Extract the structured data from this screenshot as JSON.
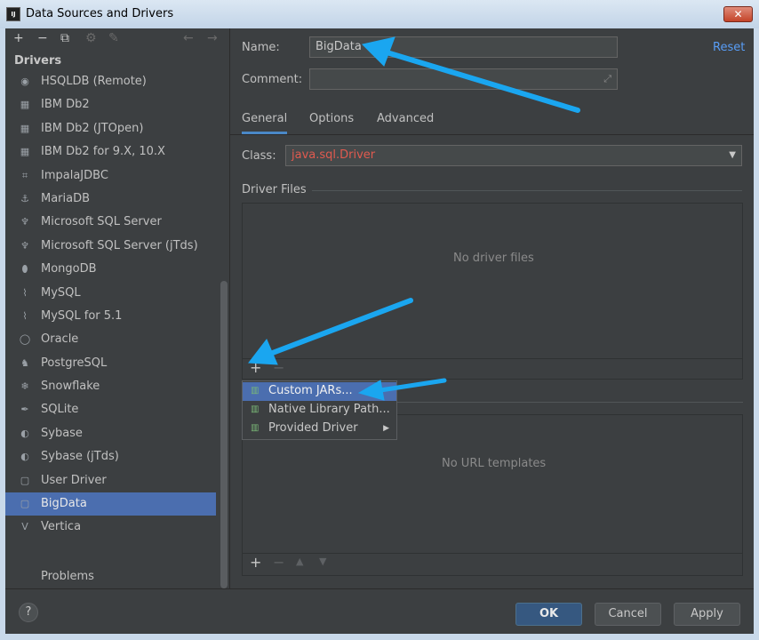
{
  "window": {
    "title": "Data Sources and Drivers",
    "close_glyph": "✕",
    "app_icon_text": "IJ"
  },
  "left_toolbar": {
    "add": "+",
    "remove": "−",
    "copy": "⧉",
    "settings": "⚙",
    "edit": "✎",
    "back": "←",
    "forward": "→"
  },
  "sidebar": {
    "section_title": "Drivers",
    "items": [
      {
        "label": "HSQLDB (Remote)",
        "icon": "◉"
      },
      {
        "label": "IBM Db2",
        "icon": "▦"
      },
      {
        "label": "IBM Db2 (JTOpen)",
        "icon": "▦"
      },
      {
        "label": "IBM Db2 for 9.X, 10.X",
        "icon": "▦"
      },
      {
        "label": "ImpalaJDBC",
        "icon": "⌗"
      },
      {
        "label": "MariaDB",
        "icon": "⚓"
      },
      {
        "label": "Microsoft SQL Server",
        "icon": "♆"
      },
      {
        "label": "Microsoft SQL Server (jTds)",
        "icon": "♆"
      },
      {
        "label": "MongoDB",
        "icon": "⬮"
      },
      {
        "label": "MySQL",
        "icon": "⌇"
      },
      {
        "label": "MySQL for 5.1",
        "icon": "⌇"
      },
      {
        "label": "Oracle",
        "icon": "◯"
      },
      {
        "label": "PostgreSQL",
        "icon": "♞"
      },
      {
        "label": "Snowflake",
        "icon": "❄"
      },
      {
        "label": "SQLite",
        "icon": "✒"
      },
      {
        "label": "Sybase",
        "icon": "◐"
      },
      {
        "label": "Sybase (jTds)",
        "icon": "◐"
      },
      {
        "label": "User Driver",
        "icon": "▢"
      },
      {
        "label": "BigData",
        "icon": "▢",
        "selected": true
      },
      {
        "label": "Vertica",
        "icon": "V"
      }
    ],
    "problems": "Problems"
  },
  "form": {
    "name_label": "Name:",
    "name_value": "BigData",
    "comment_label": "Comment:",
    "comment_value": "",
    "expand_glyph": "⤢",
    "reset": "Reset"
  },
  "tabs": [
    {
      "label": "General",
      "active": true
    },
    {
      "label": "Options",
      "active": false
    },
    {
      "label": "Advanced",
      "active": false
    }
  ],
  "class_row": {
    "label": "Class:",
    "value": "java.sql.Driver",
    "arrow": "▼"
  },
  "driver_files": {
    "title": "Driver Files",
    "empty": "No driver files",
    "add": "+",
    "remove": "−"
  },
  "popup_menu": {
    "items": [
      {
        "label": "Custom JARs...",
        "icon": "▥",
        "highlighted": true
      },
      {
        "label": "Native Library Path...",
        "icon": "▥"
      },
      {
        "label": "Provided Driver",
        "icon": "▥",
        "submenu": "▶"
      }
    ]
  },
  "url_templates": {
    "empty": "No URL templates",
    "add": "+",
    "remove": "−",
    "up": "▲",
    "down": "▼"
  },
  "buttons": {
    "help": "?",
    "ok": "OK",
    "cancel": "Cancel",
    "apply": "Apply"
  },
  "colors": {
    "accent": "#4b6eaf",
    "link": "#589df6",
    "error_text": "#e05a4f",
    "arrow": "#1aa6f0"
  }
}
